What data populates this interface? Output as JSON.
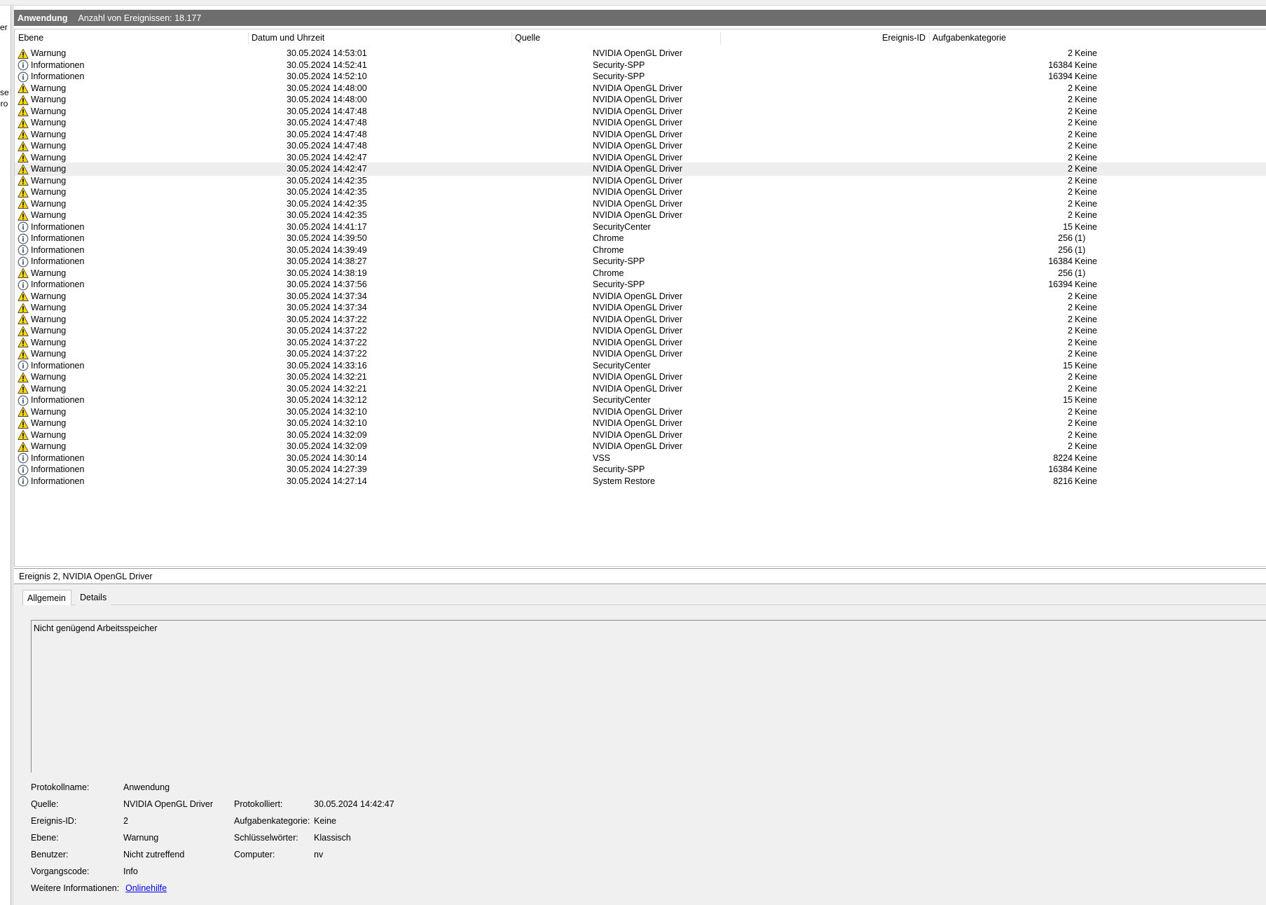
{
  "left_fragments": [
    "zer",
    "sse",
    "oro"
  ],
  "titlebar": {
    "log_name": "Anwendung",
    "count_text": "Anzahl von Ereignissen: 18.177"
  },
  "columns": {
    "level": "Ebene",
    "date": "Datum und Uhrzeit",
    "source": "Quelle",
    "event_id": "Ereignis-ID",
    "category": "Aufgabenkategorie"
  },
  "rows": [
    {
      "level": "Warnung",
      "icon": "warning-icon",
      "date": "30.05.2024 14:53:01",
      "source": "NVIDIA OpenGL Driver",
      "id": "2",
      "cat": "Keine"
    },
    {
      "level": "Informationen",
      "icon": "info-icon",
      "date": "30.05.2024 14:52:41",
      "source": "Security-SPP",
      "id": "16384",
      "cat": "Keine"
    },
    {
      "level": "Informationen",
      "icon": "info-icon",
      "date": "30.05.2024 14:52:10",
      "source": "Security-SPP",
      "id": "16394",
      "cat": "Keine"
    },
    {
      "level": "Warnung",
      "icon": "warning-icon",
      "date": "30.05.2024 14:48:00",
      "source": "NVIDIA OpenGL Driver",
      "id": "2",
      "cat": "Keine"
    },
    {
      "level": "Warnung",
      "icon": "warning-icon",
      "date": "30.05.2024 14:48:00",
      "source": "NVIDIA OpenGL Driver",
      "id": "2",
      "cat": "Keine"
    },
    {
      "level": "Warnung",
      "icon": "warning-icon",
      "date": "30.05.2024 14:47:48",
      "source": "NVIDIA OpenGL Driver",
      "id": "2",
      "cat": "Keine"
    },
    {
      "level": "Warnung",
      "icon": "warning-icon",
      "date": "30.05.2024 14:47:48",
      "source": "NVIDIA OpenGL Driver",
      "id": "2",
      "cat": "Keine"
    },
    {
      "level": "Warnung",
      "icon": "warning-icon",
      "date": "30.05.2024 14:47:48",
      "source": "NVIDIA OpenGL Driver",
      "id": "2",
      "cat": "Keine"
    },
    {
      "level": "Warnung",
      "icon": "warning-icon",
      "date": "30.05.2024 14:47:48",
      "source": "NVIDIA OpenGL Driver",
      "id": "2",
      "cat": "Keine"
    },
    {
      "level": "Warnung",
      "icon": "warning-icon",
      "date": "30.05.2024 14:42:47",
      "source": "NVIDIA OpenGL Driver",
      "id": "2",
      "cat": "Keine"
    },
    {
      "level": "Warnung",
      "icon": "warning-icon",
      "date": "30.05.2024 14:42:47",
      "source": "NVIDIA OpenGL Driver",
      "id": "2",
      "cat": "Keine",
      "selected": true
    },
    {
      "level": "Warnung",
      "icon": "warning-icon",
      "date": "30.05.2024 14:42:35",
      "source": "NVIDIA OpenGL Driver",
      "id": "2",
      "cat": "Keine"
    },
    {
      "level": "Warnung",
      "icon": "warning-icon",
      "date": "30.05.2024 14:42:35",
      "source": "NVIDIA OpenGL Driver",
      "id": "2",
      "cat": "Keine"
    },
    {
      "level": "Warnung",
      "icon": "warning-icon",
      "date": "30.05.2024 14:42:35",
      "source": "NVIDIA OpenGL Driver",
      "id": "2",
      "cat": "Keine"
    },
    {
      "level": "Warnung",
      "icon": "warning-icon",
      "date": "30.05.2024 14:42:35",
      "source": "NVIDIA OpenGL Driver",
      "id": "2",
      "cat": "Keine"
    },
    {
      "level": "Informationen",
      "icon": "info-icon",
      "date": "30.05.2024 14:41:17",
      "source": "SecurityCenter",
      "id": "15",
      "cat": "Keine"
    },
    {
      "level": "Informationen",
      "icon": "info-icon",
      "date": "30.05.2024 14:39:50",
      "source": "Chrome",
      "id": "256",
      "cat": "(1)"
    },
    {
      "level": "Informationen",
      "icon": "info-icon",
      "date": "30.05.2024 14:39:49",
      "source": "Chrome",
      "id": "256",
      "cat": "(1)"
    },
    {
      "level": "Informationen",
      "icon": "info-icon",
      "date": "30.05.2024 14:38:27",
      "source": "Security-SPP",
      "id": "16384",
      "cat": "Keine"
    },
    {
      "level": "Warnung",
      "icon": "warning-icon",
      "date": "30.05.2024 14:38:19",
      "source": "Chrome",
      "id": "256",
      "cat": "(1)"
    },
    {
      "level": "Informationen",
      "icon": "info-icon",
      "date": "30.05.2024 14:37:56",
      "source": "Security-SPP",
      "id": "16394",
      "cat": "Keine"
    },
    {
      "level": "Warnung",
      "icon": "warning-icon",
      "date": "30.05.2024 14:37:34",
      "source": "NVIDIA OpenGL Driver",
      "id": "2",
      "cat": "Keine"
    },
    {
      "level": "Warnung",
      "icon": "warning-icon",
      "date": "30.05.2024 14:37:34",
      "source": "NVIDIA OpenGL Driver",
      "id": "2",
      "cat": "Keine"
    },
    {
      "level": "Warnung",
      "icon": "warning-icon",
      "date": "30.05.2024 14:37:22",
      "source": "NVIDIA OpenGL Driver",
      "id": "2",
      "cat": "Keine"
    },
    {
      "level": "Warnung",
      "icon": "warning-icon",
      "date": "30.05.2024 14:37:22",
      "source": "NVIDIA OpenGL Driver",
      "id": "2",
      "cat": "Keine"
    },
    {
      "level": "Warnung",
      "icon": "warning-icon",
      "date": "30.05.2024 14:37:22",
      "source": "NVIDIA OpenGL Driver",
      "id": "2",
      "cat": "Keine"
    },
    {
      "level": "Warnung",
      "icon": "warning-icon",
      "date": "30.05.2024 14:37:22",
      "source": "NVIDIA OpenGL Driver",
      "id": "2",
      "cat": "Keine"
    },
    {
      "level": "Informationen",
      "icon": "info-icon",
      "date": "30.05.2024 14:33:16",
      "source": "SecurityCenter",
      "id": "15",
      "cat": "Keine"
    },
    {
      "level": "Warnung",
      "icon": "warning-icon",
      "date": "30.05.2024 14:32:21",
      "source": "NVIDIA OpenGL Driver",
      "id": "2",
      "cat": "Keine"
    },
    {
      "level": "Warnung",
      "icon": "warning-icon",
      "date": "30.05.2024 14:32:21",
      "source": "NVIDIA OpenGL Driver",
      "id": "2",
      "cat": "Keine"
    },
    {
      "level": "Informationen",
      "icon": "info-icon",
      "date": "30.05.2024 14:32:12",
      "source": "SecurityCenter",
      "id": "15",
      "cat": "Keine"
    },
    {
      "level": "Warnung",
      "icon": "warning-icon",
      "date": "30.05.2024 14:32:10",
      "source": "NVIDIA OpenGL Driver",
      "id": "2",
      "cat": "Keine"
    },
    {
      "level": "Warnung",
      "icon": "warning-icon",
      "date": "30.05.2024 14:32:10",
      "source": "NVIDIA OpenGL Driver",
      "id": "2",
      "cat": "Keine"
    },
    {
      "level": "Warnung",
      "icon": "warning-icon",
      "date": "30.05.2024 14:32:09",
      "source": "NVIDIA OpenGL Driver",
      "id": "2",
      "cat": "Keine"
    },
    {
      "level": "Warnung",
      "icon": "warning-icon",
      "date": "30.05.2024 14:32:09",
      "source": "NVIDIA OpenGL Driver",
      "id": "2",
      "cat": "Keine"
    },
    {
      "level": "Informationen",
      "icon": "info-icon",
      "date": "30.05.2024 14:30:14",
      "source": "VSS",
      "id": "8224",
      "cat": "Keine"
    },
    {
      "level": "Informationen",
      "icon": "info-icon",
      "date": "30.05.2024 14:27:39",
      "source": "Security-SPP",
      "id": "16384",
      "cat": "Keine"
    },
    {
      "level": "Informationen",
      "icon": "info-icon",
      "date": "30.05.2024 14:27:14",
      "source": "System Restore",
      "id": "8216",
      "cat": "Keine"
    }
  ],
  "detail": {
    "header": "Ereignis 2, NVIDIA OpenGL Driver",
    "tabs": [
      "Allgemein",
      "Details"
    ],
    "message": "Nicht genügend Arbeitsspeicher",
    "labels": {
      "protokollname": "Protokollname:",
      "quelle": "Quelle:",
      "ereignis_id": "Ereignis-ID:",
      "ebene": "Ebene:",
      "benutzer": "Benutzer:",
      "vorgangscode": "Vorgangscode:",
      "weitere_info": "Weitere Informationen:",
      "protokolliert": "Protokolliert:",
      "aufgabenkategorie": "Aufgabenkategorie:",
      "schluesselwoerter": "Schlüsselwörter:",
      "computer": "Computer:"
    },
    "values": {
      "protokollname": "Anwendung",
      "quelle": "NVIDIA OpenGL Driver",
      "ereignis_id": "2",
      "ebene": "Warnung",
      "benutzer": "Nicht zutreffend",
      "vorgangscode": "Info",
      "weitere_info_link": "Onlinehilfe",
      "protokolliert": "30.05.2024 14:42:47",
      "aufgabenkategorie": "Keine",
      "schluesselwoerter": "Klassisch",
      "computer": "nv"
    }
  },
  "colors": {
    "titlebar": "#6e6e6e",
    "selected_row": "#eeeeee",
    "warning": "#ffd800",
    "info_ring": "#5a6a7a",
    "link": "#0000ee"
  }
}
